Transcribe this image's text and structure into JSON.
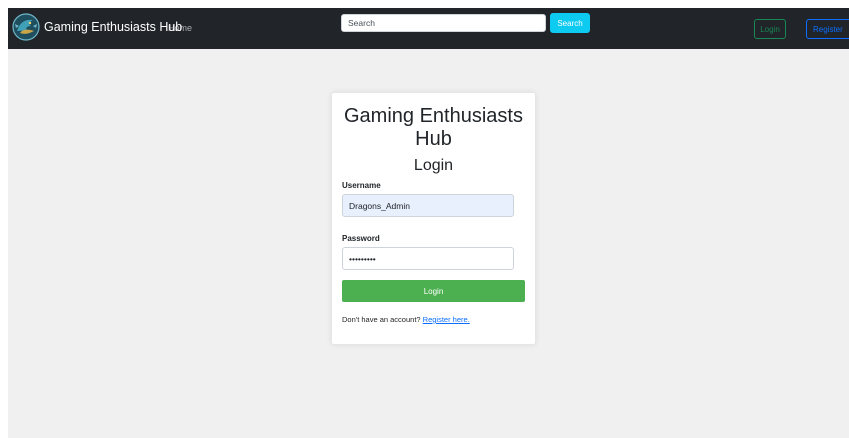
{
  "navbar": {
    "brand_name": "Gaming Enthusiasts Hub",
    "home_link": "Home",
    "search_placeholder": "Search",
    "search_button": "Search",
    "login_button": "Login",
    "register_button": "Register",
    "background_color": "#212529"
  },
  "login_card": {
    "title": "Gaming Enthusiasts Hub",
    "subtitle": "Login",
    "username_label": "Username",
    "username_value": "Dragons_Admin",
    "password_label": "Password",
    "password_value": "•••••••••",
    "submit_button": "Login",
    "register_prompt": "Don't have an account?",
    "register_link": "Register here."
  },
  "colors": {
    "page_background": "#f0f0f0",
    "submit_button": "#4caf50",
    "search_button": "#0dcaf0",
    "login_outline": "#198754",
    "register_outline": "#0d6efd",
    "link": "#0d6efd"
  },
  "icons": {
    "brand_logo": "dragon-logo-icon"
  }
}
